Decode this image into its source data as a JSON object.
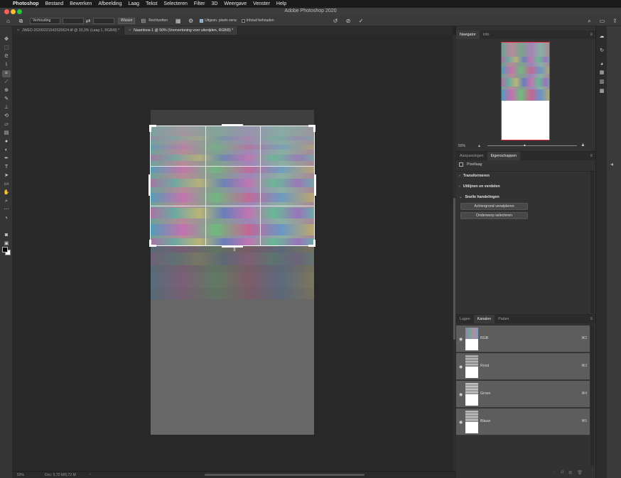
{
  "menubar": {
    "app": "Photoshop",
    "items": [
      "Bestand",
      "Bewerken",
      "Afbeelding",
      "Laag",
      "Tekst",
      "Selecteren",
      "Filter",
      "3D",
      "Weergave",
      "Venster",
      "Help"
    ]
  },
  "window": {
    "title": "Adobe Photoshop 2020"
  },
  "options": {
    "ratio": "Verhouding",
    "clear": "Wissen",
    "straighten": "Rechtzetten",
    "delete_cropped": "Uitgesn. pixels verw.",
    "content_aware": "Inhoud behouden"
  },
  "tabs": [
    {
      "label": "JWED-20200221543S20624.tif @ 33,3% (Laag 1, RGB/8) *"
    },
    {
      "label": "Naamloos-1 @ 50% (Voorvertoning voor uitsnijden, RGB/8) *"
    }
  ],
  "status": {
    "zoom": "50%",
    "docsize": "Doc: 5,72 M/5,72 M"
  },
  "navigator": {
    "tab": "Navigator",
    "tab2": "Info",
    "zoom": "50%"
  },
  "properties": {
    "tab1": "Aanpassingen",
    "tab2": "Eigenschappen",
    "header": "Pixellaag",
    "sections": [
      "Transformeren",
      "Uitlijnen en verdelen",
      "Snelle handelingen"
    ],
    "buttons": [
      "Achtergrond verwijderen",
      "Onderwerp selecteren"
    ]
  },
  "channels_panel": {
    "tabs": [
      "Lagen",
      "Kanalen",
      "Paden"
    ],
    "channels": [
      {
        "name": "RGB",
        "shortcut": "⌘2"
      },
      {
        "name": "Rood",
        "shortcut": "⌘3"
      },
      {
        "name": "Groen",
        "shortcut": "⌘4"
      },
      {
        "name": "Blauw",
        "shortcut": "⌘5"
      }
    ]
  },
  "icons": {
    "toolbar": [
      "move-icon",
      "marquee-icon",
      "lasso-icon",
      "quick-select-icon",
      "crop-icon",
      "eyedropper-icon",
      "healing-icon",
      "brush-icon",
      "stamp-icon",
      "history-brush-icon",
      "eraser-icon",
      "gradient-icon",
      "blur-icon",
      "dodge-icon",
      "pen-icon",
      "type-icon",
      "path-select-icon",
      "shape-icon",
      "hand-icon",
      "zoom-icon"
    ]
  },
  "colors": {
    "crop_frame": "#ffffff",
    "navigator_frame": "#e0283a",
    "selected_channel": "#5d5d5d"
  }
}
